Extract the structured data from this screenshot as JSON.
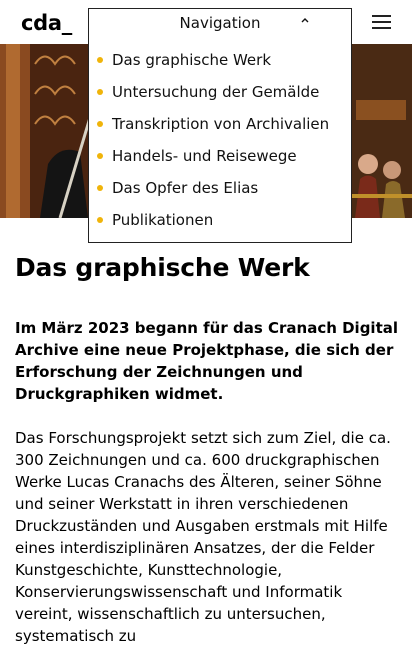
{
  "header": {
    "logo": "cda_",
    "menu_icon": "hamburger-menu-icon"
  },
  "hero": {
    "description_icon": "painting-detail-image"
  },
  "nav": {
    "title": "Navigation",
    "toggle_icon": "chevron-up-icon",
    "bullet_color": "#f0b40a",
    "items": [
      {
        "label": "Das graphische Werk"
      },
      {
        "label": "Untersuchung der Gemälde"
      },
      {
        "label": "Transkription von Archivalien"
      },
      {
        "label": "Handels- und Reisewege"
      },
      {
        "label": "Das Opfer des Elias"
      },
      {
        "label": "Publikationen"
      }
    ]
  },
  "main": {
    "title": "Das graphische Werk",
    "lead": "Im März 2023 begann für das Cranach Digital Archive eine  neue Projektphase, die sich der Erforschung der Zeichnungen und  Druckgraphiken widmet.",
    "body": "Das Forschungsprojekt setzt sich zum Ziel, die ca. 300 Zeichnungen und  ca. 600 druckgraphischen Werke Lucas Cranachs des Älteren, seiner Söhne und seiner Werkstatt in ihren verschiedenen Druckzuständen und Ausgaben  erstmals mit Hilfe eines interdisziplinären Ansatzes, der die Felder Kunstgeschichte, Kunsttechnologie, Konservierungswissenschaft und  Informatik vereint, wissenschaftlich zu untersuchen, systematisch zu"
  }
}
